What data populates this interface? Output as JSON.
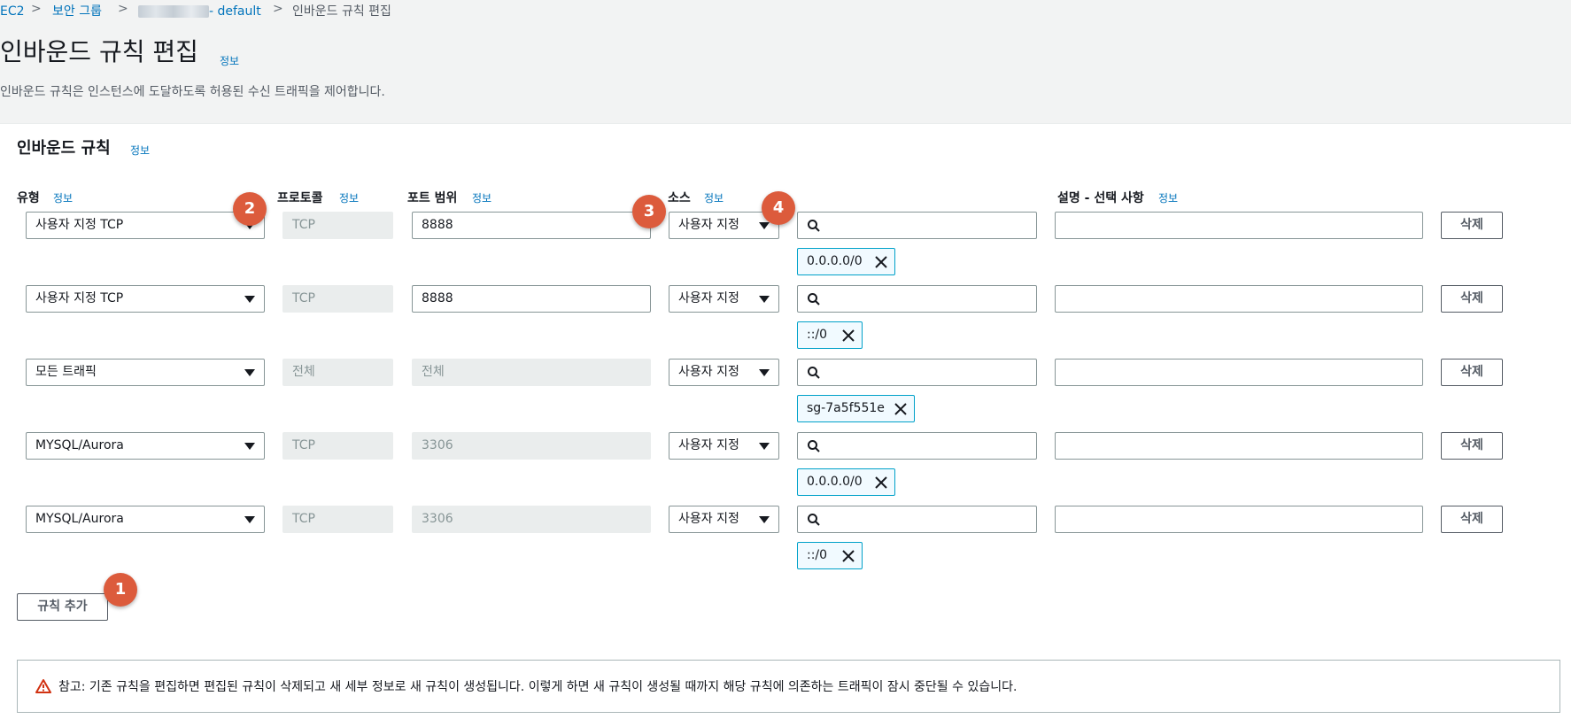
{
  "breadcrumb": {
    "items": [
      "EC2",
      "보안 그룹",
      "- default",
      "인바운드 규칙 편집"
    ],
    "separator": ">"
  },
  "page": {
    "title": "인바운드 규칙 편집",
    "info": "정보",
    "description": "인바운드 규칙은 인스턴스에 도달하도록 허용된 수신 트래픽을 제어합니다."
  },
  "panel": {
    "title": "인바운드 규칙",
    "info": "정보"
  },
  "columns": {
    "type": "유형",
    "protocol": "프로토콜",
    "port_range": "포트 범위",
    "source": "소스",
    "description": "설명 - 선택 사항",
    "info": "정보"
  },
  "rules": [
    {
      "type": "사용자 지정 TCP",
      "protocol": "TCP",
      "port": "8888",
      "source": "사용자 지정",
      "token": "0.0.0.0/0",
      "delete": "삭제"
    },
    {
      "type": "사용자 지정 TCP",
      "protocol": "TCP",
      "port": "8888",
      "source": "사용자 지정",
      "token": "::/0",
      "delete": "삭제"
    },
    {
      "type": "모든 트래픽",
      "protocol": "전체",
      "port": "전체",
      "source": "사용자 지정",
      "token": "sg-7a5f551e",
      "delete": "삭제"
    },
    {
      "type": "MYSQL/Aurora",
      "protocol": "TCP",
      "port": "3306",
      "source": "사용자 지정",
      "token": "0.0.0.0/0",
      "delete": "삭제"
    },
    {
      "type": "MYSQL/Aurora",
      "protocol": "TCP",
      "port": "3306",
      "source": "사용자 지정",
      "token": "::/0",
      "delete": "삭제"
    }
  ],
  "add_rule": "규칙 추가",
  "badges": [
    "1",
    "2",
    "3",
    "4"
  ],
  "alert": {
    "text": "참고: 기존 규칙을 편집하면 편집된 규칙이 삭제되고 새 세부 정보로 새 규칙이 생성됩니다. 이렇게 하면 새 규칙이 생성될 때까지 해당 규칙에 의존하는 트래픽이 잠시 중단될 수 있습니다."
  },
  "colors": {
    "link": "#0073bb",
    "badge": "#dc5b3c",
    "token_border": "#00a1c9",
    "warning": "#d13212"
  }
}
